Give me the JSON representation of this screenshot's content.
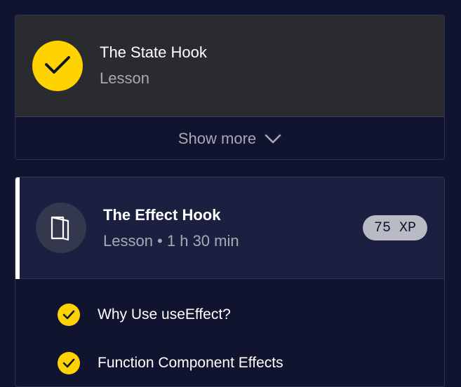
{
  "card1": {
    "title": "The State Hook",
    "subtitle": "Lesson",
    "status_icon": "check-icon",
    "show_more_label": "Show more"
  },
  "card2": {
    "title": "The Effect Hook",
    "subtitle": "Lesson • 1 h 30 min",
    "icon": "book-icon",
    "xp_badge": "75 XP",
    "items": [
      {
        "label": "Why Use useEffect?",
        "completed": true
      },
      {
        "label": "Function Component Effects",
        "completed": true
      }
    ]
  },
  "colors": {
    "background": "#10142e",
    "completed_accent": "#ffd300",
    "card_header_completed": "#2a2b2f",
    "card_header_active": "#1b2040"
  }
}
